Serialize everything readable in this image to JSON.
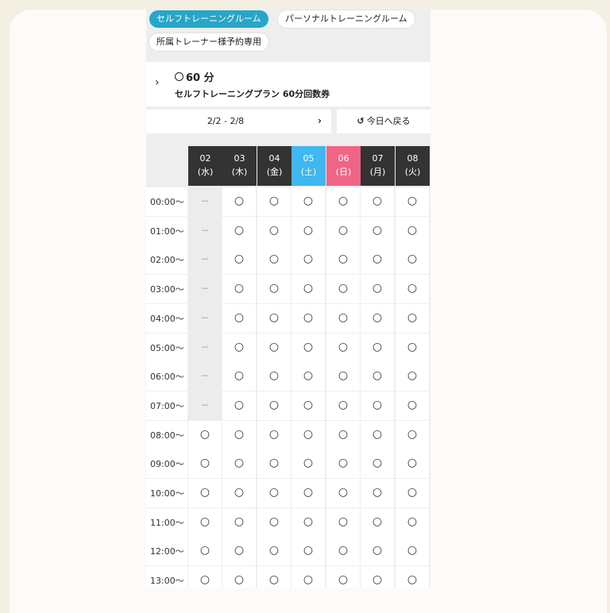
{
  "tabs": [
    {
      "label": "セルフトレーニングルーム",
      "active": true
    },
    {
      "label": "パーソナルトレーニングルーム",
      "active": false
    },
    {
      "label": "所属トレーナー様予約専用",
      "active": false
    }
  ],
  "plan": {
    "duration": "60 分",
    "name": "セルフトレーニングプラン 60分回数券"
  },
  "week": {
    "range": "2/2 - 2/8",
    "next_icon": "›",
    "today_icon": "↺",
    "today_label": "今日へ戻る"
  },
  "days": [
    {
      "date": "02",
      "dow": "(水)",
      "color": "#333333"
    },
    {
      "date": "03",
      "dow": "(木)",
      "color": "#333333"
    },
    {
      "date": "04",
      "dow": "(金)",
      "color": "#333333"
    },
    {
      "date": "05",
      "dow": "(土)",
      "color": "#3fb7f0"
    },
    {
      "date": "06",
      "dow": "(日)",
      "color": "#f06585"
    },
    {
      "date": "07",
      "dow": "(月)",
      "color": "#333333"
    },
    {
      "date": "08",
      "dow": "(火)",
      "color": "#333333"
    }
  ],
  "slots": [
    {
      "time": "00:00〜",
      "status": [
        "－",
        "○",
        "○",
        "○",
        "○",
        "○",
        "○"
      ]
    },
    {
      "time": "01:00〜",
      "status": [
        "－",
        "○",
        "○",
        "○",
        "○",
        "○",
        "○"
      ]
    },
    {
      "time": "02:00〜",
      "status": [
        "－",
        "○",
        "○",
        "○",
        "○",
        "○",
        "○"
      ]
    },
    {
      "time": "03:00〜",
      "status": [
        "－",
        "○",
        "○",
        "○",
        "○",
        "○",
        "○"
      ]
    },
    {
      "time": "04:00〜",
      "status": [
        "－",
        "○",
        "○",
        "○",
        "○",
        "○",
        "○"
      ]
    },
    {
      "time": "05:00〜",
      "status": [
        "－",
        "○",
        "○",
        "○",
        "○",
        "○",
        "○"
      ]
    },
    {
      "time": "06:00〜",
      "status": [
        "－",
        "○",
        "○",
        "○",
        "○",
        "○",
        "○"
      ]
    },
    {
      "time": "07:00〜",
      "status": [
        "－",
        "○",
        "○",
        "○",
        "○",
        "○",
        "○"
      ]
    },
    {
      "time": "08:00〜",
      "status": [
        "○",
        "○",
        "○",
        "○",
        "○",
        "○",
        "○"
      ]
    },
    {
      "time": "09:00〜",
      "status": [
        "○",
        "○",
        "○",
        "○",
        "○",
        "○",
        "○"
      ]
    },
    {
      "time": "10:00〜",
      "status": [
        "○",
        "○",
        "○",
        "○",
        "○",
        "○",
        "○"
      ]
    },
    {
      "time": "11:00〜",
      "status": [
        "○",
        "○",
        "○",
        "○",
        "○",
        "○",
        "○"
      ]
    },
    {
      "time": "12:00〜",
      "status": [
        "○",
        "○",
        "○",
        "○",
        "○",
        "○",
        "○"
      ]
    },
    {
      "time": "13:00〜",
      "status": [
        "○",
        "○",
        "○",
        "○",
        "○",
        "○",
        "○"
      ]
    }
  ],
  "colors": {
    "accent": "#26a6c8",
    "unavailable": "#ececec"
  }
}
